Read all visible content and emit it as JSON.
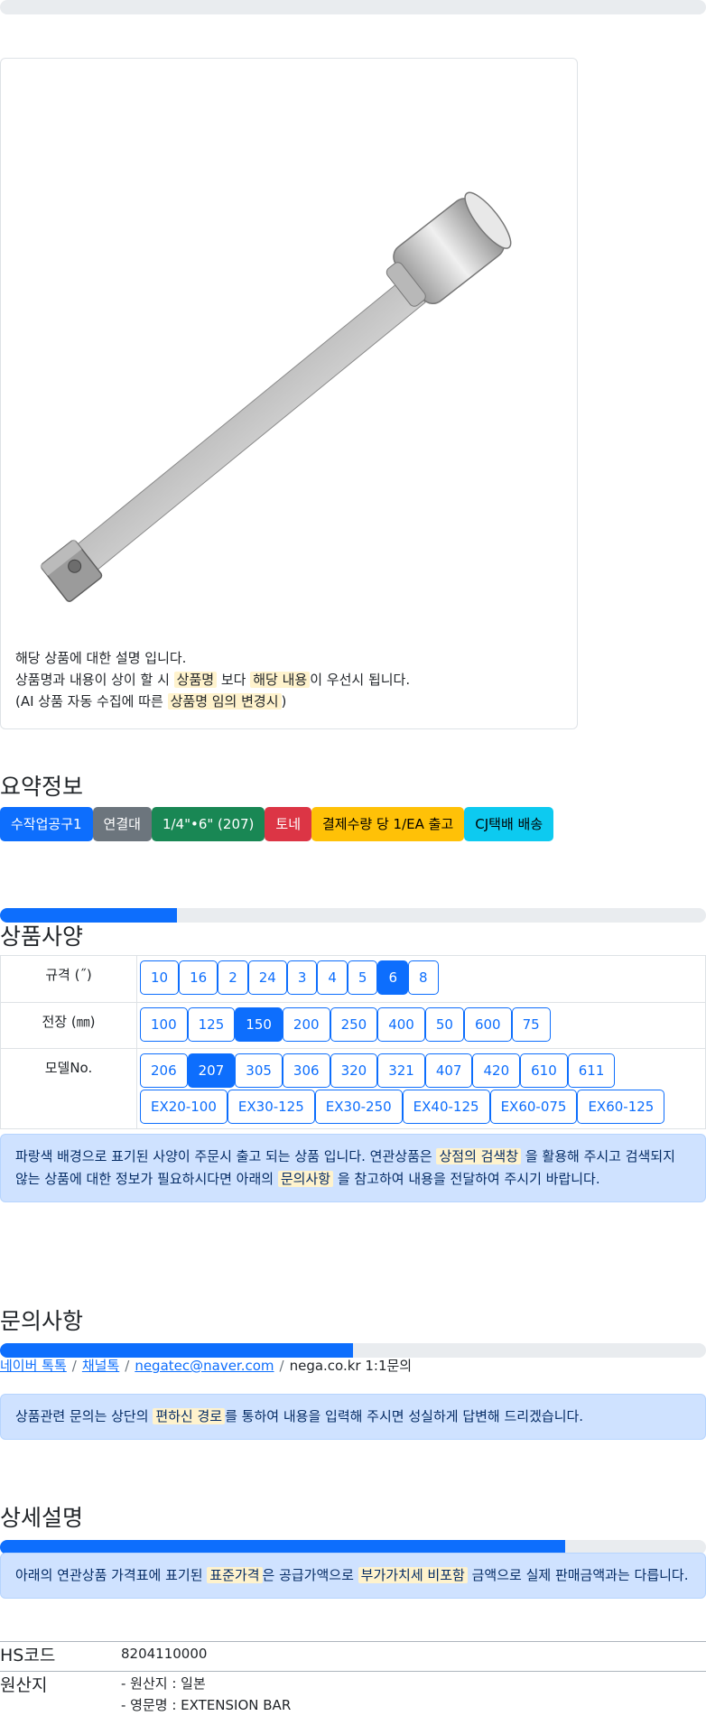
{
  "product": {
    "desc_line1": "해당 상품에 대한 설명 입니다.",
    "desc_line2_a": "상품명과 내용이 상이 할 시",
    "desc_line2_hl1": "상품명",
    "desc_line2_b": "보다",
    "desc_line2_hl2": "해당 내용",
    "desc_line2_c": "이 우선시 됩니다.",
    "desc_line3_a": "(AI 상품 자동 수집에 따른",
    "desc_line3_hl": "상품명 임의 변경시",
    "desc_line3_b": ")"
  },
  "summary": {
    "title": "요약정보",
    "badges": [
      "수작업공구1",
      "연결대",
      "1/4\"•6\" (207)",
      "토네",
      "결제수량 당 1/EA 출고",
      "CJ택배 배송"
    ]
  },
  "specs": {
    "title": "상품사양",
    "progress": 0.25,
    "rows": [
      {
        "label": "규격 (˝)",
        "options": [
          "10",
          "16",
          "2",
          "24",
          "3",
          "4",
          "5",
          "6",
          "8"
        ],
        "selected": "6"
      },
      {
        "label": "전장 (㎜)",
        "options": [
          "100",
          "125",
          "150",
          "200",
          "250",
          "400",
          "50",
          "600",
          "75"
        ],
        "selected": "150"
      },
      {
        "label": "모델No.",
        "options": [
          "206",
          "207",
          "305",
          "306",
          "320",
          "321",
          "407",
          "420",
          "610",
          "611",
          "EX20-100",
          "EX30-125",
          "EX30-250",
          "EX40-125",
          "EX60-075",
          "EX60-125"
        ],
        "selected": "207"
      }
    ],
    "notice_a": "파랑색 배경으로 표기된 사양이 주문시 출고 되는 상품 입니다. 연관상품은",
    "notice_hl1": "상점의 검색창",
    "notice_b": "을 활용해 주시고 검색되지 않는 상품에 대한 정보가 필요하시다면 아래의",
    "notice_hl2": "문의사항",
    "notice_c": "을 참고하여 내용을 전달하여 주시기 바랍니다."
  },
  "inquiry": {
    "title": "문의사항",
    "progress": 0.5,
    "links": [
      "네이버 톡톡",
      "채널톡",
      "negatec@naver.com"
    ],
    "plain": "nega.co.kr 1:1문의",
    "sep": "/",
    "notice_a": "상품관련 문의는 상단의",
    "notice_hl": "편하신 경로",
    "notice_b": "를 통하여 내용을 입력해 주시면 성실하게 답변해 드리겠습니다."
  },
  "details": {
    "title": "상세설명",
    "progress": 0.8,
    "notice_a": "아래의 연관상품 가격표에 표기된",
    "notice_hl1": "표준가격",
    "notice_b": "은 공급가액으로",
    "notice_hl2": "부가가치세 비포함",
    "notice_c": "금액으로 실제 판매금액과는 다릅니다.",
    "hs_label": "HS코드",
    "hs_value": "8204110000",
    "origin_label": "원산지",
    "origin_line1": "- 원산지 : 일본",
    "origin_line2": "- 영문명 : EXTENSION BAR"
  },
  "colors": {
    "primary": "#0d6efd",
    "highlight": "#fff3cd",
    "alert_bg": "#cfe2ff"
  }
}
